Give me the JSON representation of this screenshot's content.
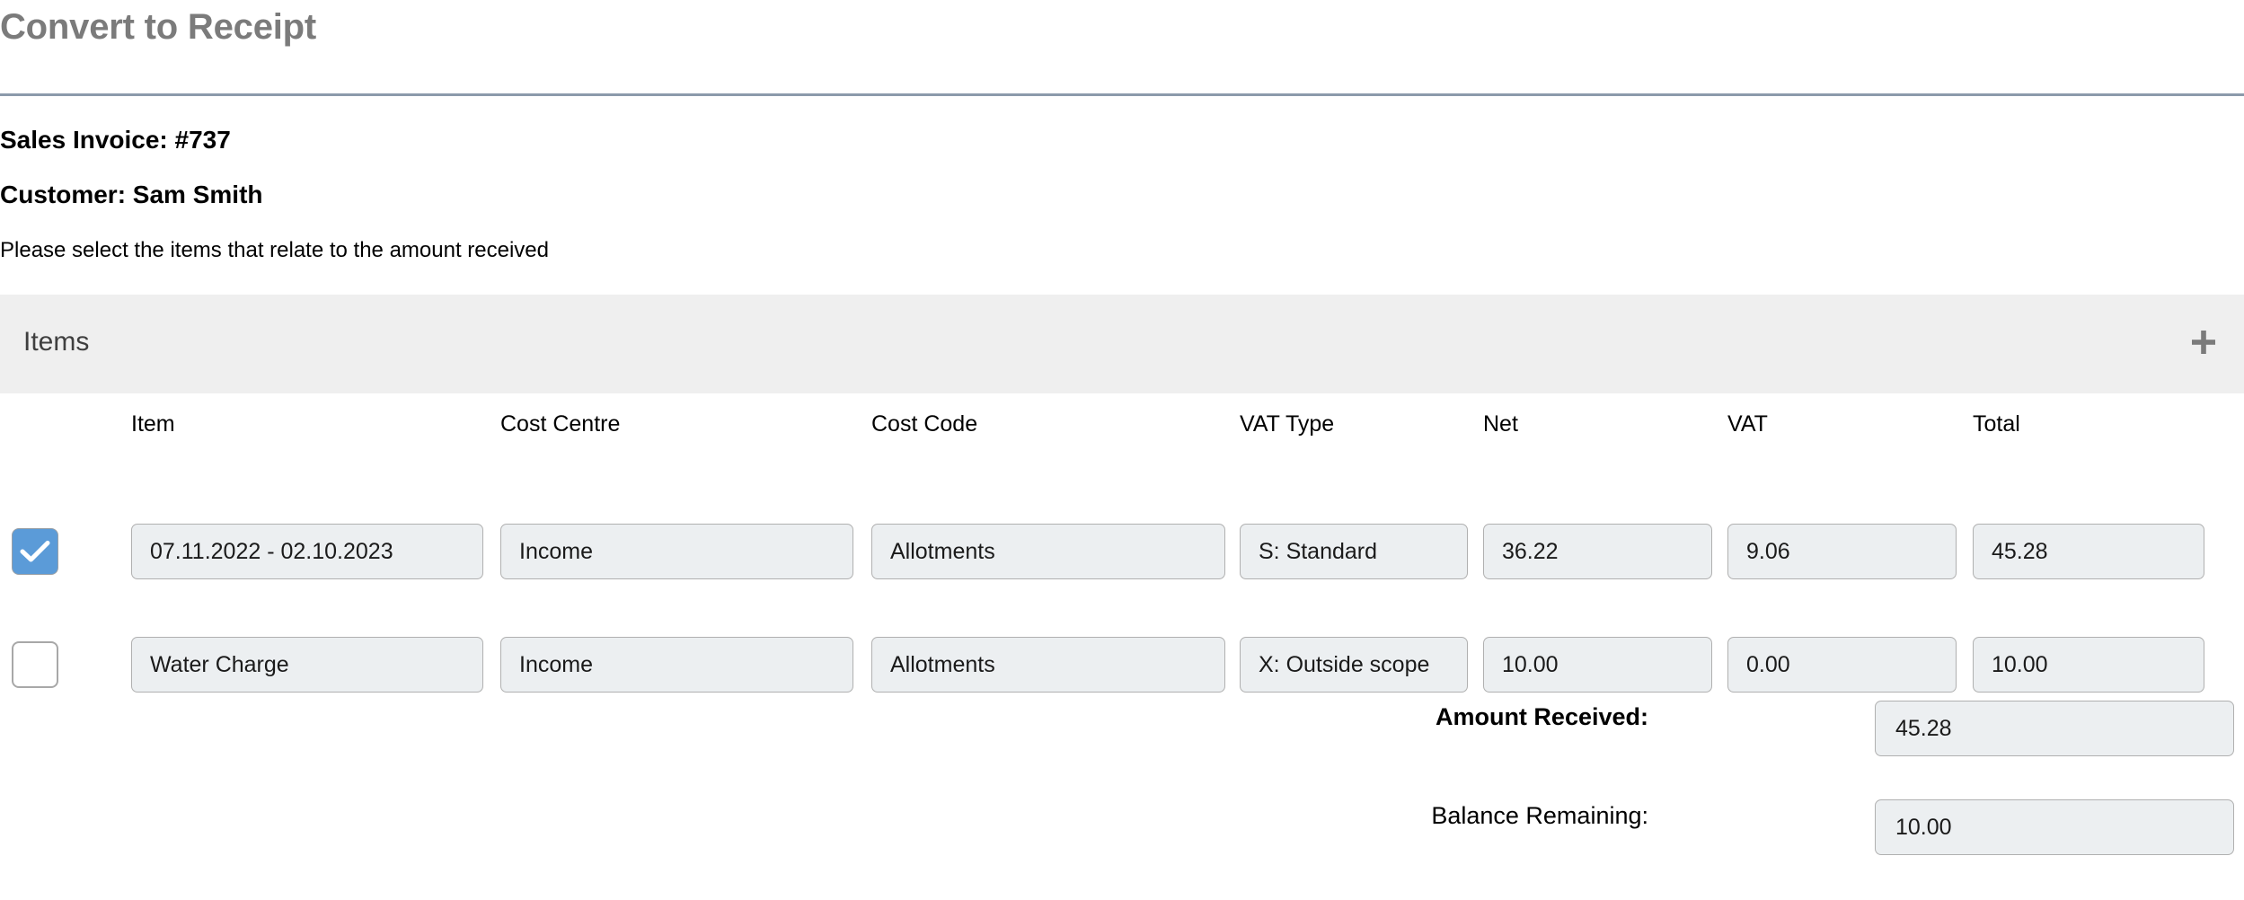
{
  "header": {
    "title": "Convert to Receipt"
  },
  "meta": {
    "invoice_label": "Sales Invoice: #737",
    "customer_label": "Customer: Sam Smith",
    "instruction": "Please select the items that relate to the amount received"
  },
  "items_panel": {
    "title": "Items",
    "add_icon": "plus-icon"
  },
  "table": {
    "columns": [
      "Item",
      "Cost Centre",
      "Cost Code",
      "VAT Type",
      "Net",
      "VAT",
      "Total"
    ],
    "rows": [
      {
        "selected": true,
        "item": "07.11.2022 - 02.10.2023",
        "cost_centre": "Income",
        "cost_code": "Allotments",
        "vat_type": "S: Standard",
        "net": "36.22",
        "vat": "9.06",
        "total": "45.28"
      },
      {
        "selected": false,
        "item": "Water Charge",
        "cost_centre": "Income",
        "cost_code": "Allotments",
        "vat_type": "X: Outside scope",
        "net": "10.00",
        "vat": "0.00",
        "total": "10.00"
      }
    ]
  },
  "summary": {
    "amount_received_label": "Amount Received:",
    "amount_received_value": "45.28",
    "balance_remaining_label": "Balance Remaining:",
    "balance_remaining_value": "10.00"
  },
  "colors": {
    "title_grey": "#7b7b7b",
    "divider": "#8b9aab",
    "panel_bar": "#efefef",
    "input_fill": "#eceff1",
    "input_border": "#b0b0b0",
    "checkbox_checked": "#5b9bd8"
  }
}
